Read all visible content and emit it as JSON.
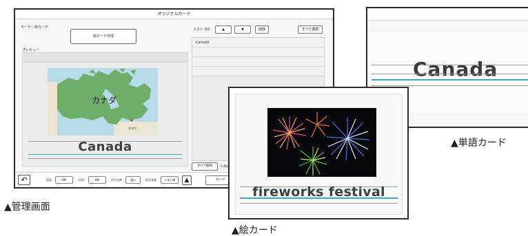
{
  "admin": {
    "title": "オリジナルカード",
    "mode_label": "モード：絵カード",
    "create_button": "絵カード作成",
    "preview_label": "プレビュー",
    "preview_map_label": "カナダ",
    "preview_map_sublabel": "オタワ",
    "preview_word": "Canada",
    "list_header": "リスト 0/0",
    "list_up": "▲",
    "list_down": "▼",
    "list_delete": "削除",
    "list_select_all": "すべて選択",
    "list_items": [
      "Canada",
      "",
      "",
      ""
    ],
    "deselect_all": "すべて解除",
    "count_text": "0 枚選",
    "bottom": {
      "undo": "↶",
      "label1": "英語",
      "btn1": "ON",
      "label2": "日本",
      "btn2": "ON",
      "label3": "再生回数",
      "btn3": "速い",
      "label4": "再生速度",
      "btn4": "リスト順",
      "up": "▲",
      "send": "カード"
    }
  },
  "word_card": {
    "word": "Canada"
  },
  "picture_card": {
    "word": "fireworks festival"
  },
  "captions": {
    "admin": "▲管理画面",
    "word_card": "▲単語カード",
    "picture_card": "▲絵カード"
  },
  "colors": {
    "line_blue": "#3fa7c9",
    "line_gray": "#9a9a9a",
    "map_land": "#6fae6a",
    "map_water": "#b8dbea"
  }
}
